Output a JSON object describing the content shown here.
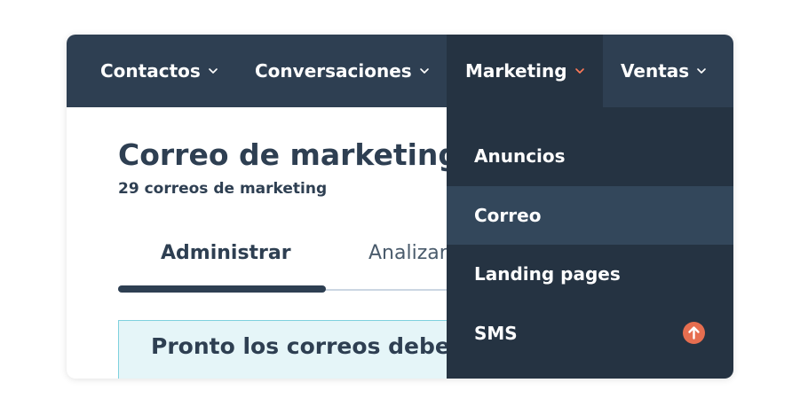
{
  "nav": {
    "contacts_label": "Contactos",
    "conversations_label": "Conversaciones",
    "marketing_label": "Marketing",
    "sales_label": "Ventas"
  },
  "page": {
    "title": "Correo de marketing",
    "subtitle": "29 correos de marketing"
  },
  "tabs": {
    "manage_label": "Administrar",
    "analyze_label": "Analizar"
  },
  "banner": {
    "text": "Pronto los correos deber"
  },
  "dropdown": {
    "items": [
      {
        "label": "Anuncios"
      },
      {
        "label": "Correo"
      },
      {
        "label": "Landing pages"
      },
      {
        "label": "SMS"
      }
    ],
    "upgrade_icon": "arrow-up-circle-icon"
  },
  "colors": {
    "nav_bg": "#2e3f52",
    "dropdown_bg": "#253342",
    "highlight_bg": "#33475b",
    "active_chevron": "#ff7a59",
    "upgrade_badge": "#e66e50",
    "banner_bg": "#e5f5f8",
    "banner_border": "#7fd1de"
  }
}
